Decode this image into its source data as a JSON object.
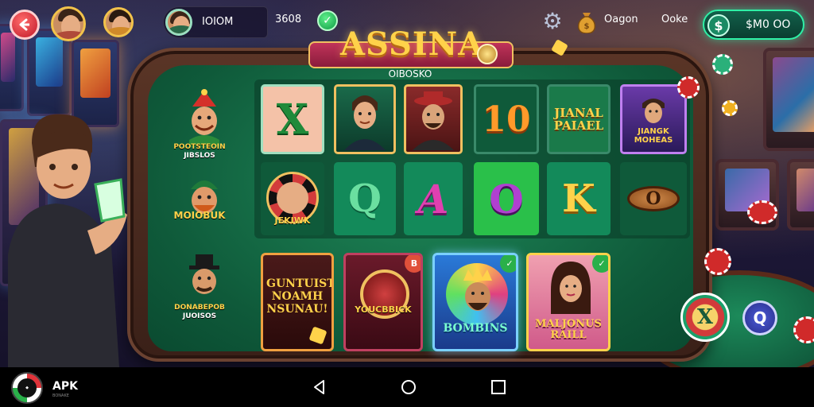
{
  "topbar": {
    "player_name": "IOIOM",
    "score": "3608",
    "bonus_label": "Oagon",
    "stats_label": "Ooke",
    "balance": "$M0 OO"
  },
  "header": {
    "title": "ASSINA",
    "subtitle": "OIBOSKO"
  },
  "left_characters": [
    {
      "label": "POOTSTEOIN",
      "sub": "JIBSLOS"
    },
    {
      "label": "MOIOBUK",
      "sub": ""
    },
    {
      "label": "DONABEPOB",
      "sub": "JUOISOS"
    }
  ],
  "reels": {
    "row1": [
      "X",
      "",
      "",
      "10",
      "JIANAL PAIAEL",
      "JIANGK MOHEAS"
    ],
    "row2": [
      "JEKIWK",
      "Q",
      "A",
      "O",
      "K",
      "O"
    ]
  },
  "cards": [
    {
      "label": "GUNTUIST NOAMH NSUNAU!"
    },
    {
      "label": "YOUCBBICK"
    },
    {
      "label": "BOMBINS"
    },
    {
      "label": "MALJONUS RAILL"
    }
  ],
  "table_chips": {
    "chip1": "X",
    "chip2": "Q"
  },
  "navbar": {
    "brand": "APK",
    "brand_sub": "BONAKE"
  },
  "colors": {
    "accent_gold": "#ffd24a",
    "felt_green": "#1f8a5a",
    "balance_border": "#2ff0a6"
  }
}
